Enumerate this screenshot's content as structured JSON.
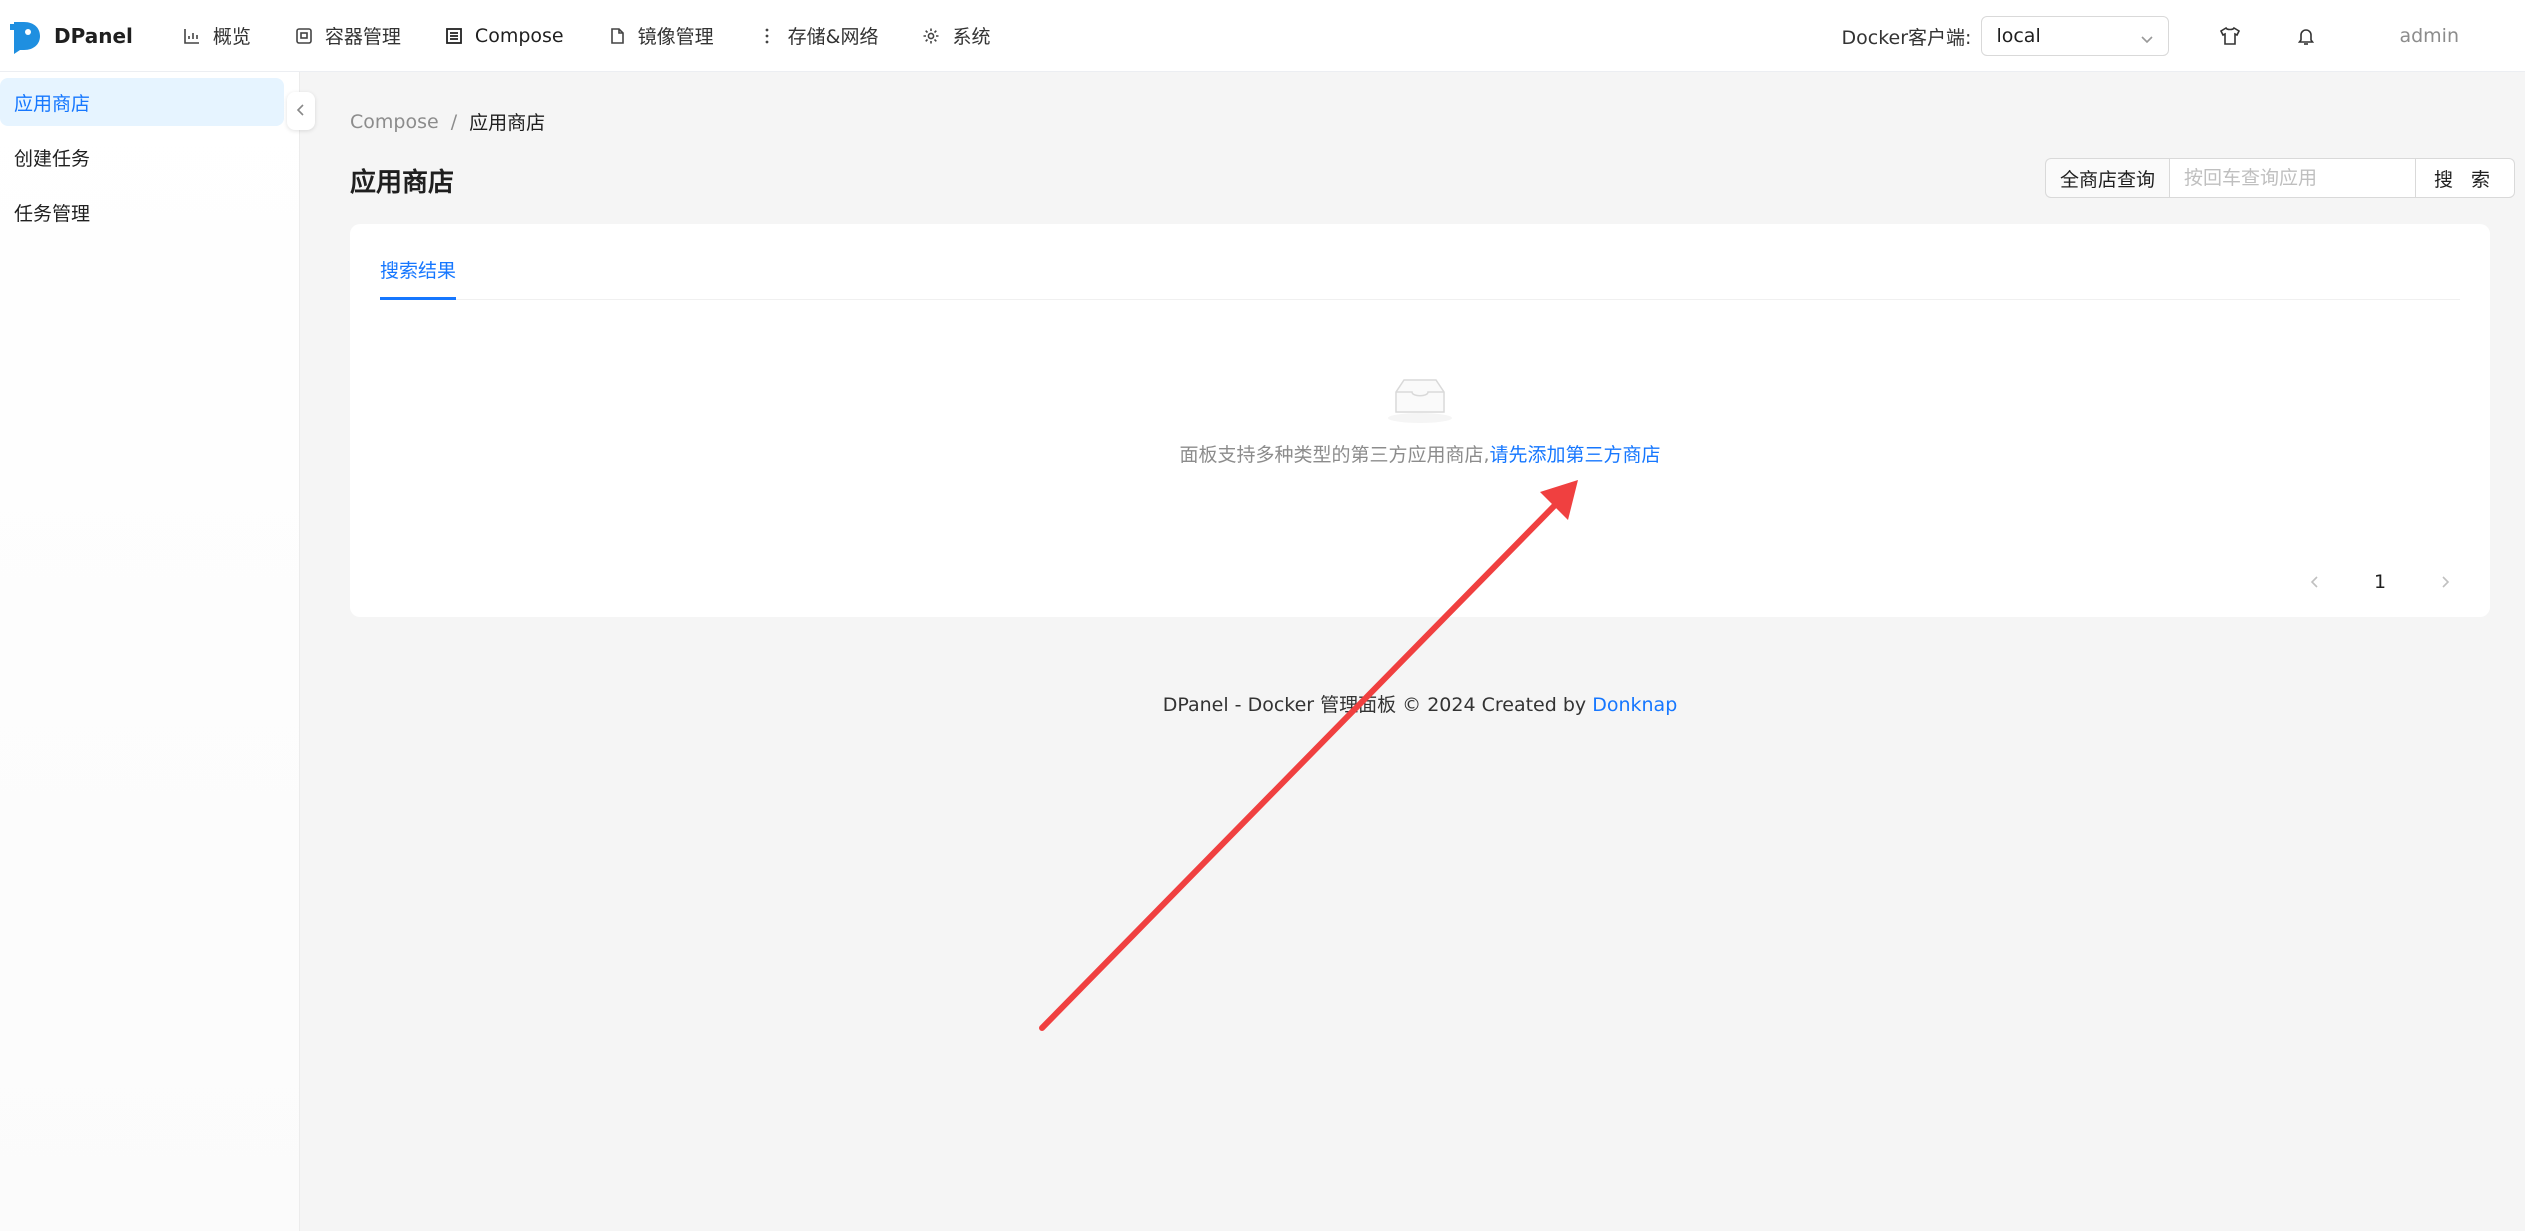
{
  "header": {
    "app_name": "DPanel",
    "nav": [
      {
        "label": "概览",
        "icon": "chart-icon"
      },
      {
        "label": "容器管理",
        "icon": "container-icon"
      },
      {
        "label": "Compose",
        "icon": "compose-icon"
      },
      {
        "label": "镜像管理",
        "icon": "file-icon"
      },
      {
        "label": "存储&网络",
        "icon": "more-vertical-icon"
      },
      {
        "label": "系统",
        "icon": "gear-icon"
      }
    ],
    "client_label": "Docker客户端:",
    "client_value": "local",
    "user": "admin"
  },
  "sidebar": {
    "items": [
      {
        "label": "应用商店",
        "active": true
      },
      {
        "label": "创建任务",
        "active": false
      },
      {
        "label": "任务管理",
        "active": false
      }
    ]
  },
  "breadcrumb": {
    "parent": "Compose",
    "separator": "/",
    "current": "应用商店"
  },
  "page": {
    "title": "应用商店"
  },
  "search": {
    "addon": "全商店查询",
    "placeholder": "按回车查询应用",
    "button": "搜 索"
  },
  "tabs": {
    "active": "搜索结果"
  },
  "empty": {
    "text": "面板支持多种类型的第三方应用商店,",
    "link": "请先添加第三方商店"
  },
  "pagination": {
    "current": "1"
  },
  "footer": {
    "text": "DPanel - Docker 管理面板 © 2024 Created by",
    "link": "Donknap"
  },
  "colors": {
    "accent": "#1677ff",
    "annotation_arrow": "#f04040"
  }
}
